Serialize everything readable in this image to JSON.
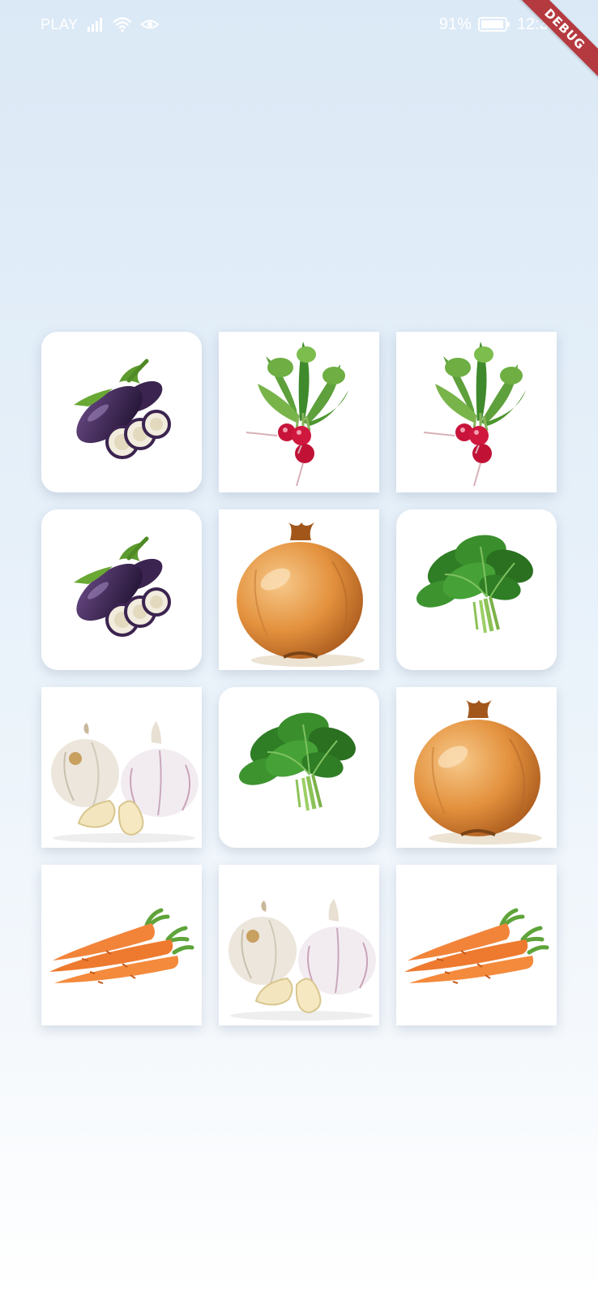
{
  "status_bar": {
    "carrier": "PLAY",
    "battery": "91%",
    "time": "12:31"
  },
  "debug_banner": {
    "label": "DEBUG"
  },
  "grid": {
    "columns": 3,
    "cards": [
      {
        "vegetable": "eggplant",
        "shape": "rounded"
      },
      {
        "vegetable": "radish",
        "shape": "square"
      },
      {
        "vegetable": "radish",
        "shape": "square"
      },
      {
        "vegetable": "eggplant",
        "shape": "rounded"
      },
      {
        "vegetable": "onion",
        "shape": "square"
      },
      {
        "vegetable": "spinach",
        "shape": "rounded"
      },
      {
        "vegetable": "garlic",
        "shape": "square"
      },
      {
        "vegetable": "spinach",
        "shape": "rounded"
      },
      {
        "vegetable": "onion",
        "shape": "square"
      },
      {
        "vegetable": "carrot",
        "shape": "square"
      },
      {
        "vegetable": "garlic",
        "shape": "square"
      },
      {
        "vegetable": "carrot",
        "shape": "square"
      }
    ]
  }
}
